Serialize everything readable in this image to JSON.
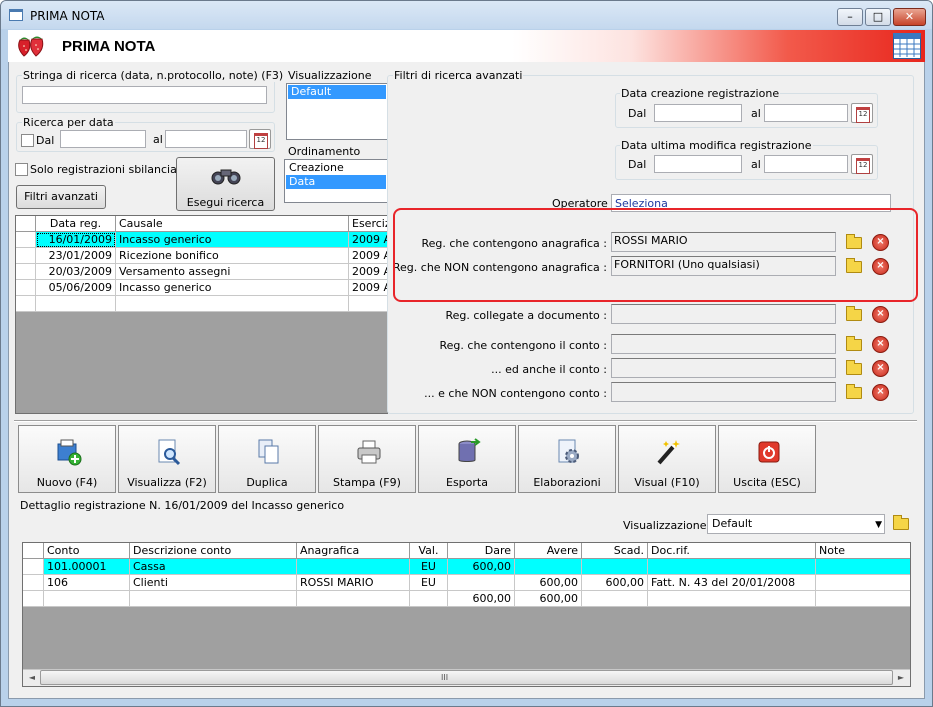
{
  "window": {
    "title": "PRIMA NOTA",
    "header_title": "PRIMA NOTA",
    "min_label": "–",
    "max_label": "□",
    "close_label": "✕"
  },
  "search": {
    "string_label": "Stringa di ricerca (data, n.protocollo, note) (F3)",
    "string_value": "",
    "date_group_label": "Ricerca per data",
    "dal_label": "Dal",
    "al_label": "al",
    "unbalanced_label": "Solo registrazioni sbilanciate",
    "advanced_button": "Filtri avanzati",
    "execute_button": "Esegui ricerca"
  },
  "view": {
    "label": "Visualizzazione",
    "options": [
      "Default"
    ],
    "selected": "Default"
  },
  "order": {
    "label": "Ordinamento",
    "options": [
      "Creazione",
      "Data"
    ],
    "selected": "Data"
  },
  "advanced": {
    "title": "Filtri di ricerca avanzati",
    "created_label": "Data creazione registrazione",
    "modified_label": "Data ultima modifica registrazione",
    "dal_label": "Dal",
    "al_label": "al",
    "operator_label": "Operatore :",
    "operator_value": "Seleziona",
    "rows": [
      {
        "label": "Reg. che contengono anagrafica :",
        "value": "ROSSI MARIO"
      },
      {
        "label": "Reg. che NON contengono anagrafica :",
        "value": "FORNITORI (Uno qualsiasi)"
      },
      {
        "label": "Reg. collegate a documento :",
        "value": ""
      },
      {
        "label": "Reg. che contengono il conto :",
        "value": ""
      },
      {
        "label": "... ed anche il conto :",
        "value": ""
      },
      {
        "label": "... e che NON contengono conto :",
        "value": ""
      }
    ],
    "calendar_glyph": "12"
  },
  "registrations": {
    "columns": [
      "Data reg.",
      "Causale",
      "Eserciz"
    ],
    "rows": [
      {
        "date": "16/01/2009",
        "causale": "Incasso generico",
        "esercizio": "2009 A"
      },
      {
        "date": "23/01/2009",
        "causale": "Ricezione bonifico",
        "esercizio": "2009 A"
      },
      {
        "date": "20/03/2009",
        "causale": "Versamento assegni",
        "esercizio": "2009 A"
      },
      {
        "date": "05/06/2009",
        "causale": "Incasso generico",
        "esercizio": "2009 A"
      }
    ]
  },
  "toolbar": {
    "buttons": [
      "Nuovo (F4)",
      "Visualizza (F2)",
      "Duplica",
      "Stampa (F9)",
      "Esporta",
      "Elaborazioni",
      "Visual (F10)",
      "Uscita (ESC)"
    ]
  },
  "detail": {
    "title": "Dettaglio registrazione N. 16/01/2009 del Incasso generico",
    "view_label": "Visualizzazione :",
    "view_value": "Default",
    "dropdown_arrow": "▼",
    "columns": [
      "Conto",
      "Descrizione conto",
      "Anagrafica",
      "Val.",
      "Dare",
      "Avere",
      "Scad.",
      "Doc.rif.",
      "Note"
    ],
    "rows": [
      {
        "conto": "101.00001",
        "descr": "Cassa",
        "anag": "",
        "val": "EU",
        "dare": "600,00",
        "avere": "",
        "scad": "",
        "doc": "",
        "note": ""
      },
      {
        "conto": "106",
        "descr": "Clienti",
        "anag": "ROSSI MARIO",
        "val": "EU",
        "dare": "",
        "avere": "600,00",
        "scad": "600,00",
        "doc": "Fatt. N. 43 del 20/01/2008",
        "note": ""
      }
    ],
    "totals": {
      "dare": "600,00",
      "avere": "600,00"
    },
    "scroll_left": "◄",
    "scroll_right": "►",
    "scroll_thumb": "III"
  },
  "colors": {
    "highlight_row": "#00ffff",
    "selection": "#3399ff",
    "annotation": "#e8252a"
  }
}
